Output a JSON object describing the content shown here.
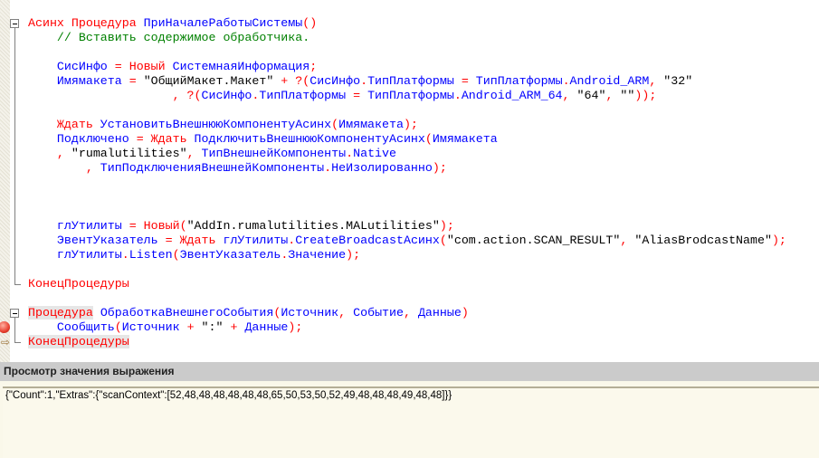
{
  "code_lines": [
    [
      [
        "Асинх Процедура ",
        "k"
      ],
      [
        "ПриНачалеРаботыСистемы",
        "i"
      ],
      [
        "()",
        "k"
      ]
    ],
    [
      [
        "    // Вставить содержимое обработчика.",
        "c"
      ]
    ],
    [],
    [
      [
        "    СисИнфо",
        "i"
      ],
      [
        " = Новый ",
        "k"
      ],
      [
        "СистемнаяИнформация",
        "i"
      ],
      [
        ";",
        "k"
      ]
    ],
    [
      [
        "    Имямакета",
        "i"
      ],
      [
        " = ",
        "k"
      ],
      [
        "\"ОбщийМакет.Макет\"",
        "s"
      ],
      [
        " + ?(",
        "k"
      ],
      [
        "СисИнфо",
        "i"
      ],
      [
        ".",
        "k"
      ],
      [
        "ТипПлатформы",
        "i"
      ],
      [
        " = ",
        "k"
      ],
      [
        "ТипПлатформы",
        "i"
      ],
      [
        ".",
        "k"
      ],
      [
        "Android_ARM",
        "i"
      ],
      [
        ", ",
        "k"
      ],
      [
        "\"32\"",
        "s"
      ]
    ],
    [
      [
        "                    , ?(",
        "k"
      ],
      [
        "СисИнфо",
        "i"
      ],
      [
        ".",
        "k"
      ],
      [
        "ТипПлатформы",
        "i"
      ],
      [
        " = ",
        "k"
      ],
      [
        "ТипПлатформы",
        "i"
      ],
      [
        ".",
        "k"
      ],
      [
        "Android_ARM_64",
        "i"
      ],
      [
        ", ",
        "k"
      ],
      [
        "\"64\"",
        "s"
      ],
      [
        ", ",
        "k"
      ],
      [
        "\"\"",
        "s"
      ],
      [
        "));",
        "k"
      ]
    ],
    [],
    [
      [
        "    Ждать ",
        "k"
      ],
      [
        "УстановитьВнешнююКомпонентуАсинх",
        "i"
      ],
      [
        "(",
        "k"
      ],
      [
        "Имямакета",
        "i"
      ],
      [
        ");",
        "k"
      ]
    ],
    [
      [
        "    Подключено",
        "i"
      ],
      [
        " = Ждать ",
        "k"
      ],
      [
        "ПодключитьВнешнююКомпонентуАсинх",
        "i"
      ],
      [
        "(",
        "k"
      ],
      [
        "Имямакета",
        "i"
      ]
    ],
    [
      [
        "    , ",
        "k"
      ],
      [
        "\"rumalutilities\"",
        "s"
      ],
      [
        ", ",
        "k"
      ],
      [
        "ТипВнешнейКомпоненты",
        "i"
      ],
      [
        ".",
        "k"
      ],
      [
        "Native",
        "i"
      ]
    ],
    [
      [
        "        , ",
        "k"
      ],
      [
        "ТипПодключенияВнешнейКомпоненты",
        "i"
      ],
      [
        ".",
        "k"
      ],
      [
        "НеИзолированно",
        "i"
      ],
      [
        ");",
        "k"
      ]
    ],
    [],
    [],
    [],
    [
      [
        "    глУтилиты",
        "i"
      ],
      [
        " = Новый(",
        "k"
      ],
      [
        "\"AddIn.rumalutilities.MALutilities\"",
        "s"
      ],
      [
        ");",
        "k"
      ]
    ],
    [
      [
        "    ЭвентУказатель",
        "i"
      ],
      [
        " = Ждать ",
        "k"
      ],
      [
        "глУтилиты",
        "i"
      ],
      [
        ".",
        "k"
      ],
      [
        "CreateBroadcastАсинх",
        "i"
      ],
      [
        "(",
        "k"
      ],
      [
        "\"com.action.SCAN_RESULT\"",
        "s"
      ],
      [
        ", ",
        "k"
      ],
      [
        "\"AliasBrodcastName\"",
        "s"
      ],
      [
        ");",
        "k"
      ]
    ],
    [
      [
        "    глУтилиты",
        "i"
      ],
      [
        ".",
        "k"
      ],
      [
        "Listen",
        "i"
      ],
      [
        "(",
        "k"
      ],
      [
        "ЭвентУказатель",
        "i"
      ],
      [
        ".",
        "k"
      ],
      [
        "Значение",
        "i"
      ],
      [
        ");",
        "k"
      ]
    ],
    [],
    [
      [
        "КонецПроцедуры",
        "k"
      ]
    ],
    [],
    [
      [
        "Процедура",
        "k hl"
      ],
      [
        " ",
        "s"
      ],
      [
        "ОбработкаВнешнегоСобытия",
        "i"
      ],
      [
        "(",
        "k"
      ],
      [
        "Источник",
        "i"
      ],
      [
        ", ",
        "k"
      ],
      [
        "Событие",
        "i"
      ],
      [
        ", ",
        "k"
      ],
      [
        "Данные",
        "i"
      ],
      [
        ")",
        "k"
      ]
    ],
    [
      [
        "    Сообщить",
        "i"
      ],
      [
        "(",
        "k"
      ],
      [
        "Источник",
        "i"
      ],
      [
        " + ",
        "k"
      ],
      [
        "\":\"",
        "s"
      ],
      [
        " + ",
        "k"
      ],
      [
        "Данные",
        "i"
      ],
      [
        ");",
        "k"
      ]
    ],
    [
      [
        "КонецПроцедуры",
        "k hl"
      ]
    ]
  ],
  "panel": {
    "title": "Просмотр значения выражения",
    "value": "{\"Count\":1,\"Extras\":{\"scanContext\":[52,48,48,48,48,48,48,65,50,53,50,52,49,48,48,48,49,48,48]}}"
  },
  "colors": {
    "keyword": "#ff0000",
    "identifier": "#0000ff",
    "comment": "#008000",
    "string": "#000000"
  }
}
